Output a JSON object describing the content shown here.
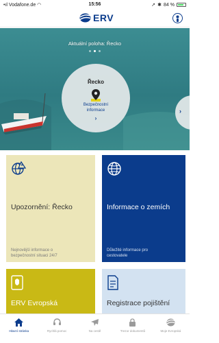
{
  "status_bar": {
    "carrier": "Vodafone.de",
    "time": "15:56",
    "battery": "84 %",
    "battery_level": 0.84
  },
  "app": {
    "logo_text": "ERV"
  },
  "hero": {
    "location_label": "Aktuální poloha: Řecko",
    "page_count": 3,
    "active_page": 1,
    "country": "Řecko",
    "country_link_line1": "Bezpečnostní",
    "country_link_line2": "informace",
    "chevron": "›"
  },
  "tiles": [
    {
      "title": "Upozornění: Řecko",
      "subtitle_line1": "Nejnovější informace o",
      "subtitle_line2": "bezpečnostní situaci 24/7",
      "icon": "globe-alert-icon",
      "color": "#ece6b9"
    },
    {
      "title": "Informace o zemích",
      "subtitle_line1": "Důležité informace pro",
      "subtitle_line2": "cestovatele",
      "icon": "globe-icon",
      "color": "#0b3c8c"
    },
    {
      "title": "ERV Evropská",
      "icon": "insurance-card-icon",
      "color": "#c9b915"
    },
    {
      "title": "Registrace pojištění",
      "icon": "document-icon",
      "color": "#d3e2f1"
    }
  ],
  "tabs": [
    {
      "label": "Hlavní stránka",
      "icon": "home-icon",
      "active": true
    },
    {
      "label": "Rychlá pomoc",
      "icon": "headset-icon",
      "active": false
    },
    {
      "label": "Na cestě",
      "icon": "airplane-icon",
      "active": false
    },
    {
      "label": "Trezor dokumentů",
      "icon": "lock-icon",
      "active": false
    },
    {
      "label": "Moje Evropská",
      "icon": "erv-logo-icon",
      "active": false
    }
  ],
  "colors": {
    "brand_blue": "#0b3c8c",
    "sea": "#3f8f95",
    "accent_yellow": "#c9b915"
  }
}
